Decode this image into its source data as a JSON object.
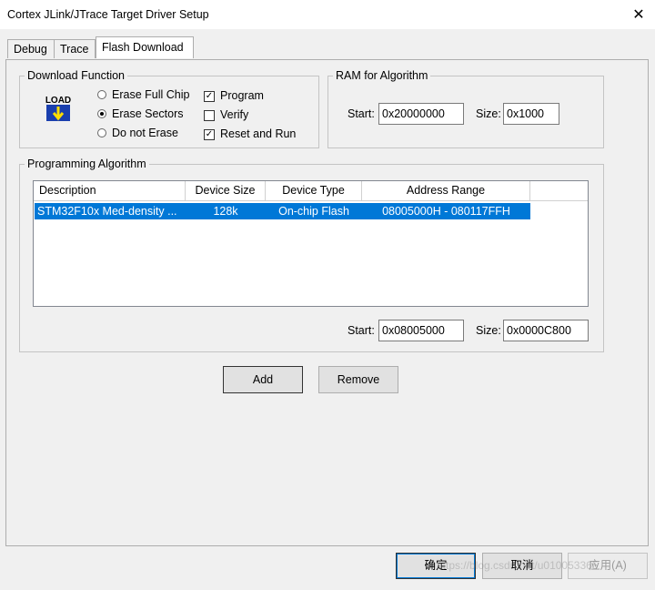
{
  "window": {
    "title": "Cortex JLink/JTrace Target Driver Setup",
    "close_glyph": "✕"
  },
  "tabs": [
    {
      "label": "Debug"
    },
    {
      "label": "Trace"
    },
    {
      "label": "Flash Download",
      "active": true
    }
  ],
  "download_function": {
    "title": "Download Function",
    "icon_text": "LOAD",
    "options": [
      {
        "label": "Erase Full Chip",
        "selected": false
      },
      {
        "label": "Erase Sectors",
        "selected": true
      },
      {
        "label": "Do not Erase",
        "selected": false
      }
    ],
    "checks": [
      {
        "label": "Program",
        "checked": true
      },
      {
        "label": "Verify",
        "checked": false
      },
      {
        "label": "Reset and Run",
        "checked": true
      }
    ]
  },
  "ram_for_algorithm": {
    "title": "RAM for Algorithm",
    "start_label": "Start:",
    "start_value": "0x20000000",
    "size_label": "Size:",
    "size_value": "0x1000"
  },
  "programming_algorithm": {
    "title": "Programming Algorithm",
    "columns": [
      "Description",
      "Device Size",
      "Device Type",
      "Address Range"
    ],
    "rows": [
      {
        "description": "STM32F10x Med-density ...",
        "size": "128k",
        "type": "On-chip Flash",
        "range": "08005000H - 080117FFH",
        "selected": true
      }
    ],
    "start_label": "Start:",
    "start_value": "0x08005000",
    "size_label": "Size:",
    "size_value": "0x0000C800",
    "add_label": "Add",
    "remove_label": "Remove"
  },
  "footer": {
    "ok_label": "确定",
    "cancel_label": "取消",
    "apply_label": "应用(A)"
  },
  "watermark": "https://blog.csdn.net/u010053365",
  "colors": {
    "selection": "#0078d7",
    "dialog_bg": "#f0f0f0"
  }
}
